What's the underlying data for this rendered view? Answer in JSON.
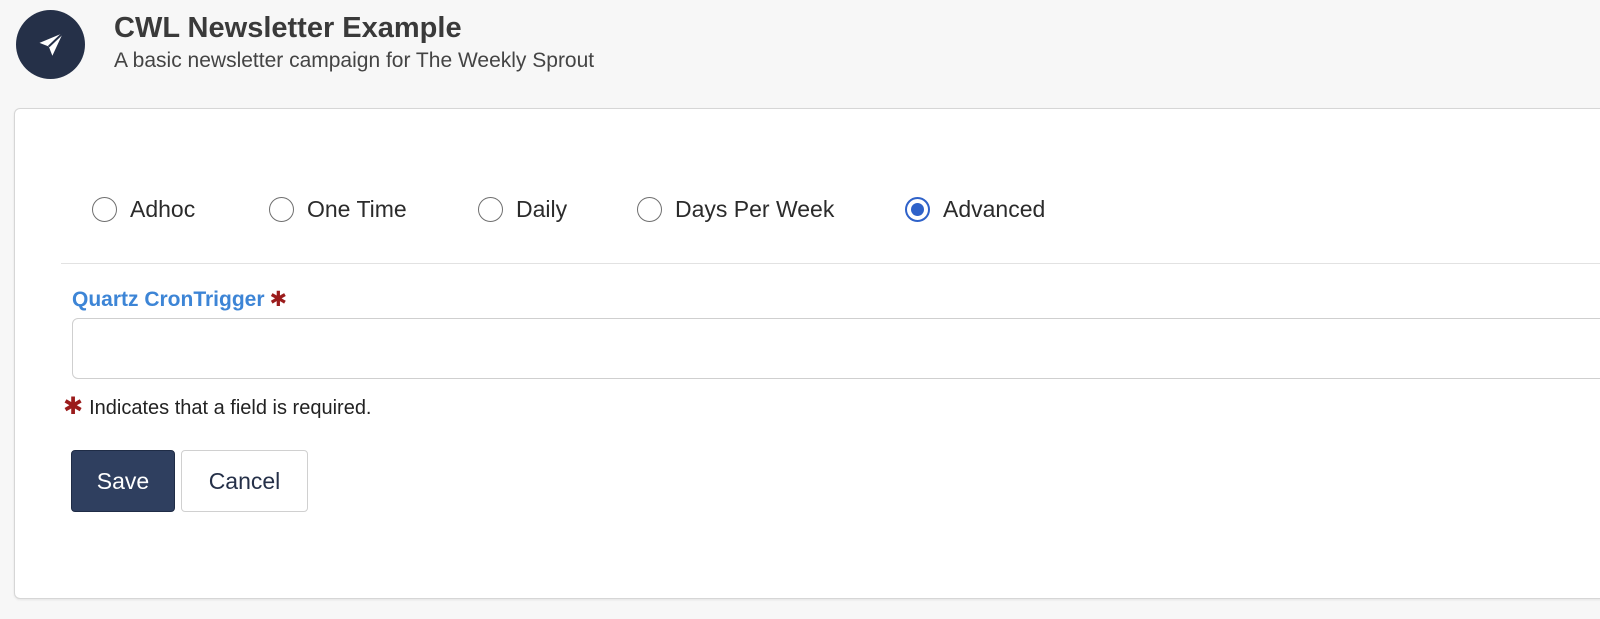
{
  "header": {
    "icon": "paper-plane-icon",
    "title": "CWL Newsletter Example",
    "subtitle": "A basic newsletter campaign for The Weekly Sprout"
  },
  "schedule": {
    "options": [
      {
        "label": "Adhoc",
        "checked": false
      },
      {
        "label": "One Time",
        "checked": false
      },
      {
        "label": "Daily",
        "checked": false
      },
      {
        "label": "Days Per Week",
        "checked": false
      },
      {
        "label": "Advanced",
        "checked": true
      }
    ]
  },
  "cron_field": {
    "label": "Quartz CronTrigger",
    "required_marker": "✱",
    "value": "",
    "placeholder": ""
  },
  "required_note": {
    "marker": "✱",
    "text": "Indicates that a field is required."
  },
  "actions": {
    "save_label": "Save",
    "cancel_label": "Cancel"
  },
  "colors": {
    "primary": "#2f3f5f",
    "radio_accent": "#2f62c9",
    "label_blue": "#3d85d6",
    "required_red": "#9b1c1c"
  }
}
